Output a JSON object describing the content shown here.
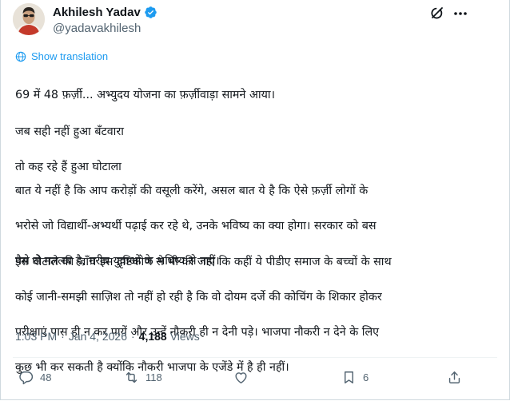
{
  "author": {
    "name": "Akhilesh Yadav",
    "handle": "@yadavakhilesh"
  },
  "header": {
    "grok_icon": "grok-icon",
    "more_icon": "more-icon"
  },
  "translate": {
    "label": "Show translation",
    "icon": "globe-icon"
  },
  "post": {
    "p1": "69 में 48 फ़र्ज़ी... अभ्युदय योजना का फ़र्ज़ीवाड़ा सामने आया।",
    "p2_line1": "जब सही नहीं हुआ बँटवारा",
    "p2_line2": "तो कह रहे हैं हुआ घोटाला",
    "p3_line1": "बात ये नहीं है कि आप करोड़ों की वसूली करेंगे, असल बात ये है कि ऐसे फ़र्ज़ी लोगों के",
    "p3_line2": "भरोसे जो विद्यार्थी-अभ्यर्थी पढ़ाई कर रहे थे, उनके भविष्य का क्या होगा। सरकार को बस",
    "p3_line3": "पैसे से मतलब है, ग़रीब युवाओं के भविष्य से नहीं।",
    "p4_line1": "इस घोटाले की जाँच इस दृष्टिकोण से भी की जाए कि कहीं ये पीडीए समाज के बच्चों के साथ",
    "p4_line2": "कोई जानी-समझी साज़िश तो नहीं हो रही है कि वो दोयम दर्जे की कोचिंग के शिकार होकर",
    "p4_line3": "परीक्षाएं पास ही न कर पायें और उन्हें नौकरी ही न देनी पड़े। भाजपा नौकरी न देने के लिए",
    "p4_line4": "कुछ भी कर सकती है क्योंकि नौकरी भाजपा के एजेंडे में है ही नहीं।"
  },
  "meta": {
    "time": "1:03 PM",
    "dot1": "·",
    "date": "Jan 4, 2026",
    "dot2": "·",
    "views_count": "4,188",
    "views_label": "Views"
  },
  "actions": {
    "replies": "48",
    "reposts": "118",
    "likes": "",
    "bookmarks": "6"
  },
  "colors": {
    "accent": "#1d9bf0",
    "secondary_text": "#536471",
    "verified": "#1d9bf0"
  }
}
